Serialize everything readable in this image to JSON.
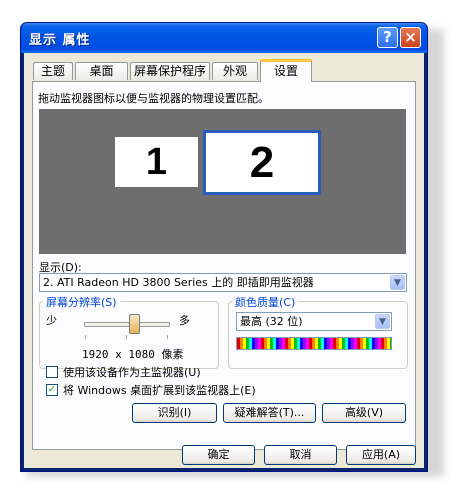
{
  "window": {
    "title": "显示 属性",
    "help_label": "?",
    "close_label": "×"
  },
  "tabs": [
    {
      "label": "主题"
    },
    {
      "label": "桌面"
    },
    {
      "label": "屏幕保护程序"
    },
    {
      "label": "外观"
    },
    {
      "label": "设置"
    }
  ],
  "active_tab": "设置",
  "settings": {
    "instruction": "拖动监视器图标以便与监视器的物理设置匹配。",
    "monitors": [
      {
        "number": "1"
      },
      {
        "number": "2",
        "selected": true
      }
    ],
    "display_label": "显示(D):",
    "display_value": "2. ATI Radeon HD 3800 Series  上的 即插即用监视器",
    "resolution": {
      "group_title": "屏幕分辨率(S)",
      "less_label": "少",
      "more_label": "多",
      "value": "1920 x 1080 像素",
      "slider_level_fraction": 0.6
    },
    "color_quality": {
      "group_title": "颜色质量(C)",
      "value": "最高 (32 位)"
    },
    "checkboxes": [
      {
        "label": "使用该设备作为主监视器(U)",
        "checked": false
      },
      {
        "label": "将 Windows 桌面扩展到该监视器上(E)",
        "checked": true
      }
    ],
    "buttons": {
      "identify": "识别(I)",
      "troubleshoot": "疑难解答(T)...",
      "advanced": "高级(V)"
    }
  },
  "dialog_buttons": {
    "ok": "确定",
    "cancel": "取消",
    "apply": "应用(A)"
  },
  "colors": {
    "titlebar": "#0055e5",
    "dialog_bg": "#ece9d8",
    "monitor_area": "#6e6e6e",
    "active_tab_highlight": "#ffc83c",
    "group_title": "#0046d5"
  }
}
